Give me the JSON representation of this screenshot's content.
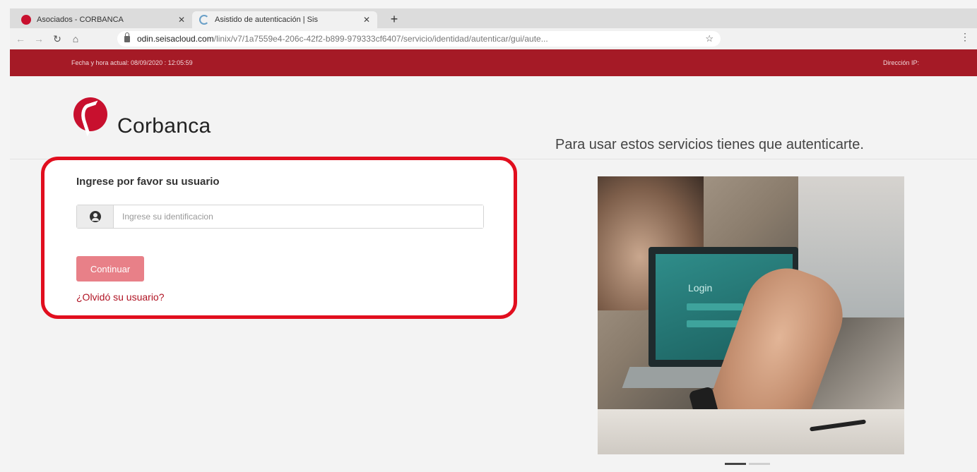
{
  "browser": {
    "tabs": [
      {
        "title": "Asociados - CORBANCA",
        "active": false
      },
      {
        "title": "Asistido de autenticación | Sis",
        "active": true
      }
    ],
    "url_host": "odin.seisacloud.com",
    "url_path": "/linix/v7/1a7559e4-206c-42f2-b899-979333cf6407/servicio/identidad/autenticar/gui/aute..."
  },
  "topbar": {
    "datetime": "Fecha y hora actual: 08/09/2020 : 12:05:59",
    "ip": "Dirección IP:"
  },
  "header": {
    "brand": "Corbanca",
    "auth_message": "Para usar estos servicios tienes que autenticarte."
  },
  "login": {
    "title": "Ingrese por favor su usuario",
    "input_placeholder": "Ingrese su identificacion",
    "input_value": "",
    "continue_label": "Continuar",
    "forgot_label": "¿Olvidó su usuario?"
  },
  "photo": {
    "screen_text": "Login"
  },
  "colors": {
    "brand_red": "#a51a26",
    "highlight_border": "#e10e1e",
    "button_disabled": "#e88088",
    "link": "#b01323"
  }
}
